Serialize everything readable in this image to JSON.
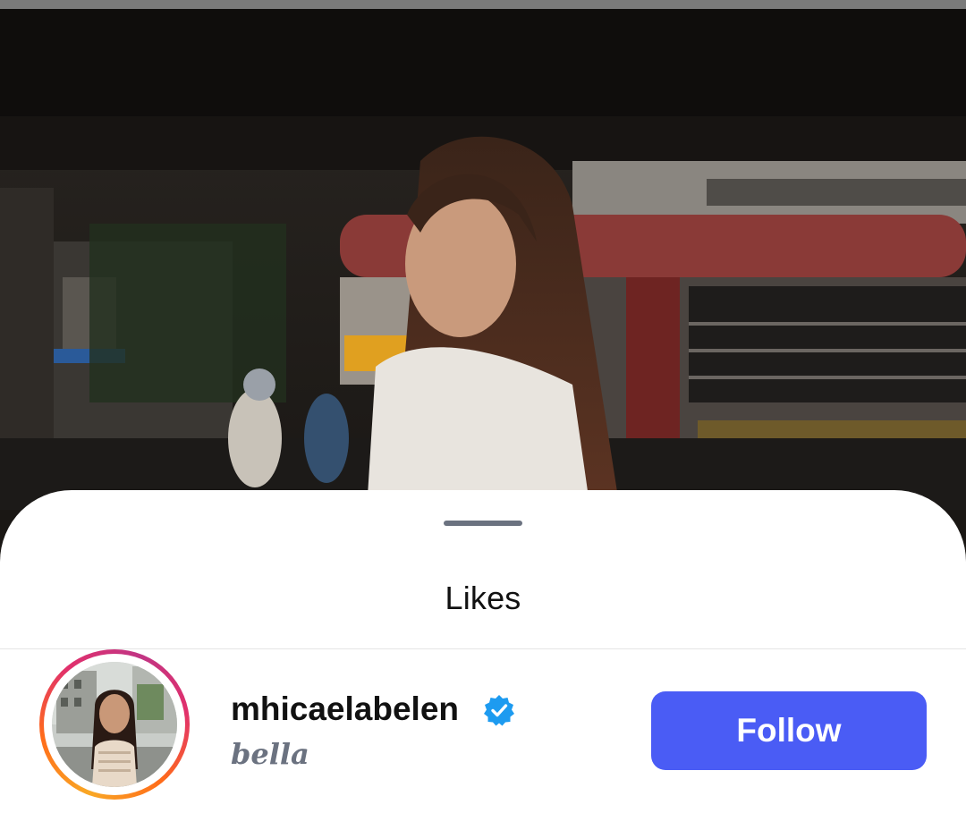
{
  "sheet": {
    "title": "Likes"
  },
  "likes": [
    {
      "username": "mhicaelabelen",
      "verified": true,
      "full_name": "bella",
      "follow_label": "Follow",
      "story_ring": true,
      "icons": {
        "verified": "verified-badge-icon",
        "avatar": "avatar"
      }
    }
  ],
  "colors": {
    "follow_button": "#4a5cf5",
    "verified_badge": "#1d9bf0",
    "ring_start": "#f9a825",
    "ring_end": "#c13584"
  }
}
